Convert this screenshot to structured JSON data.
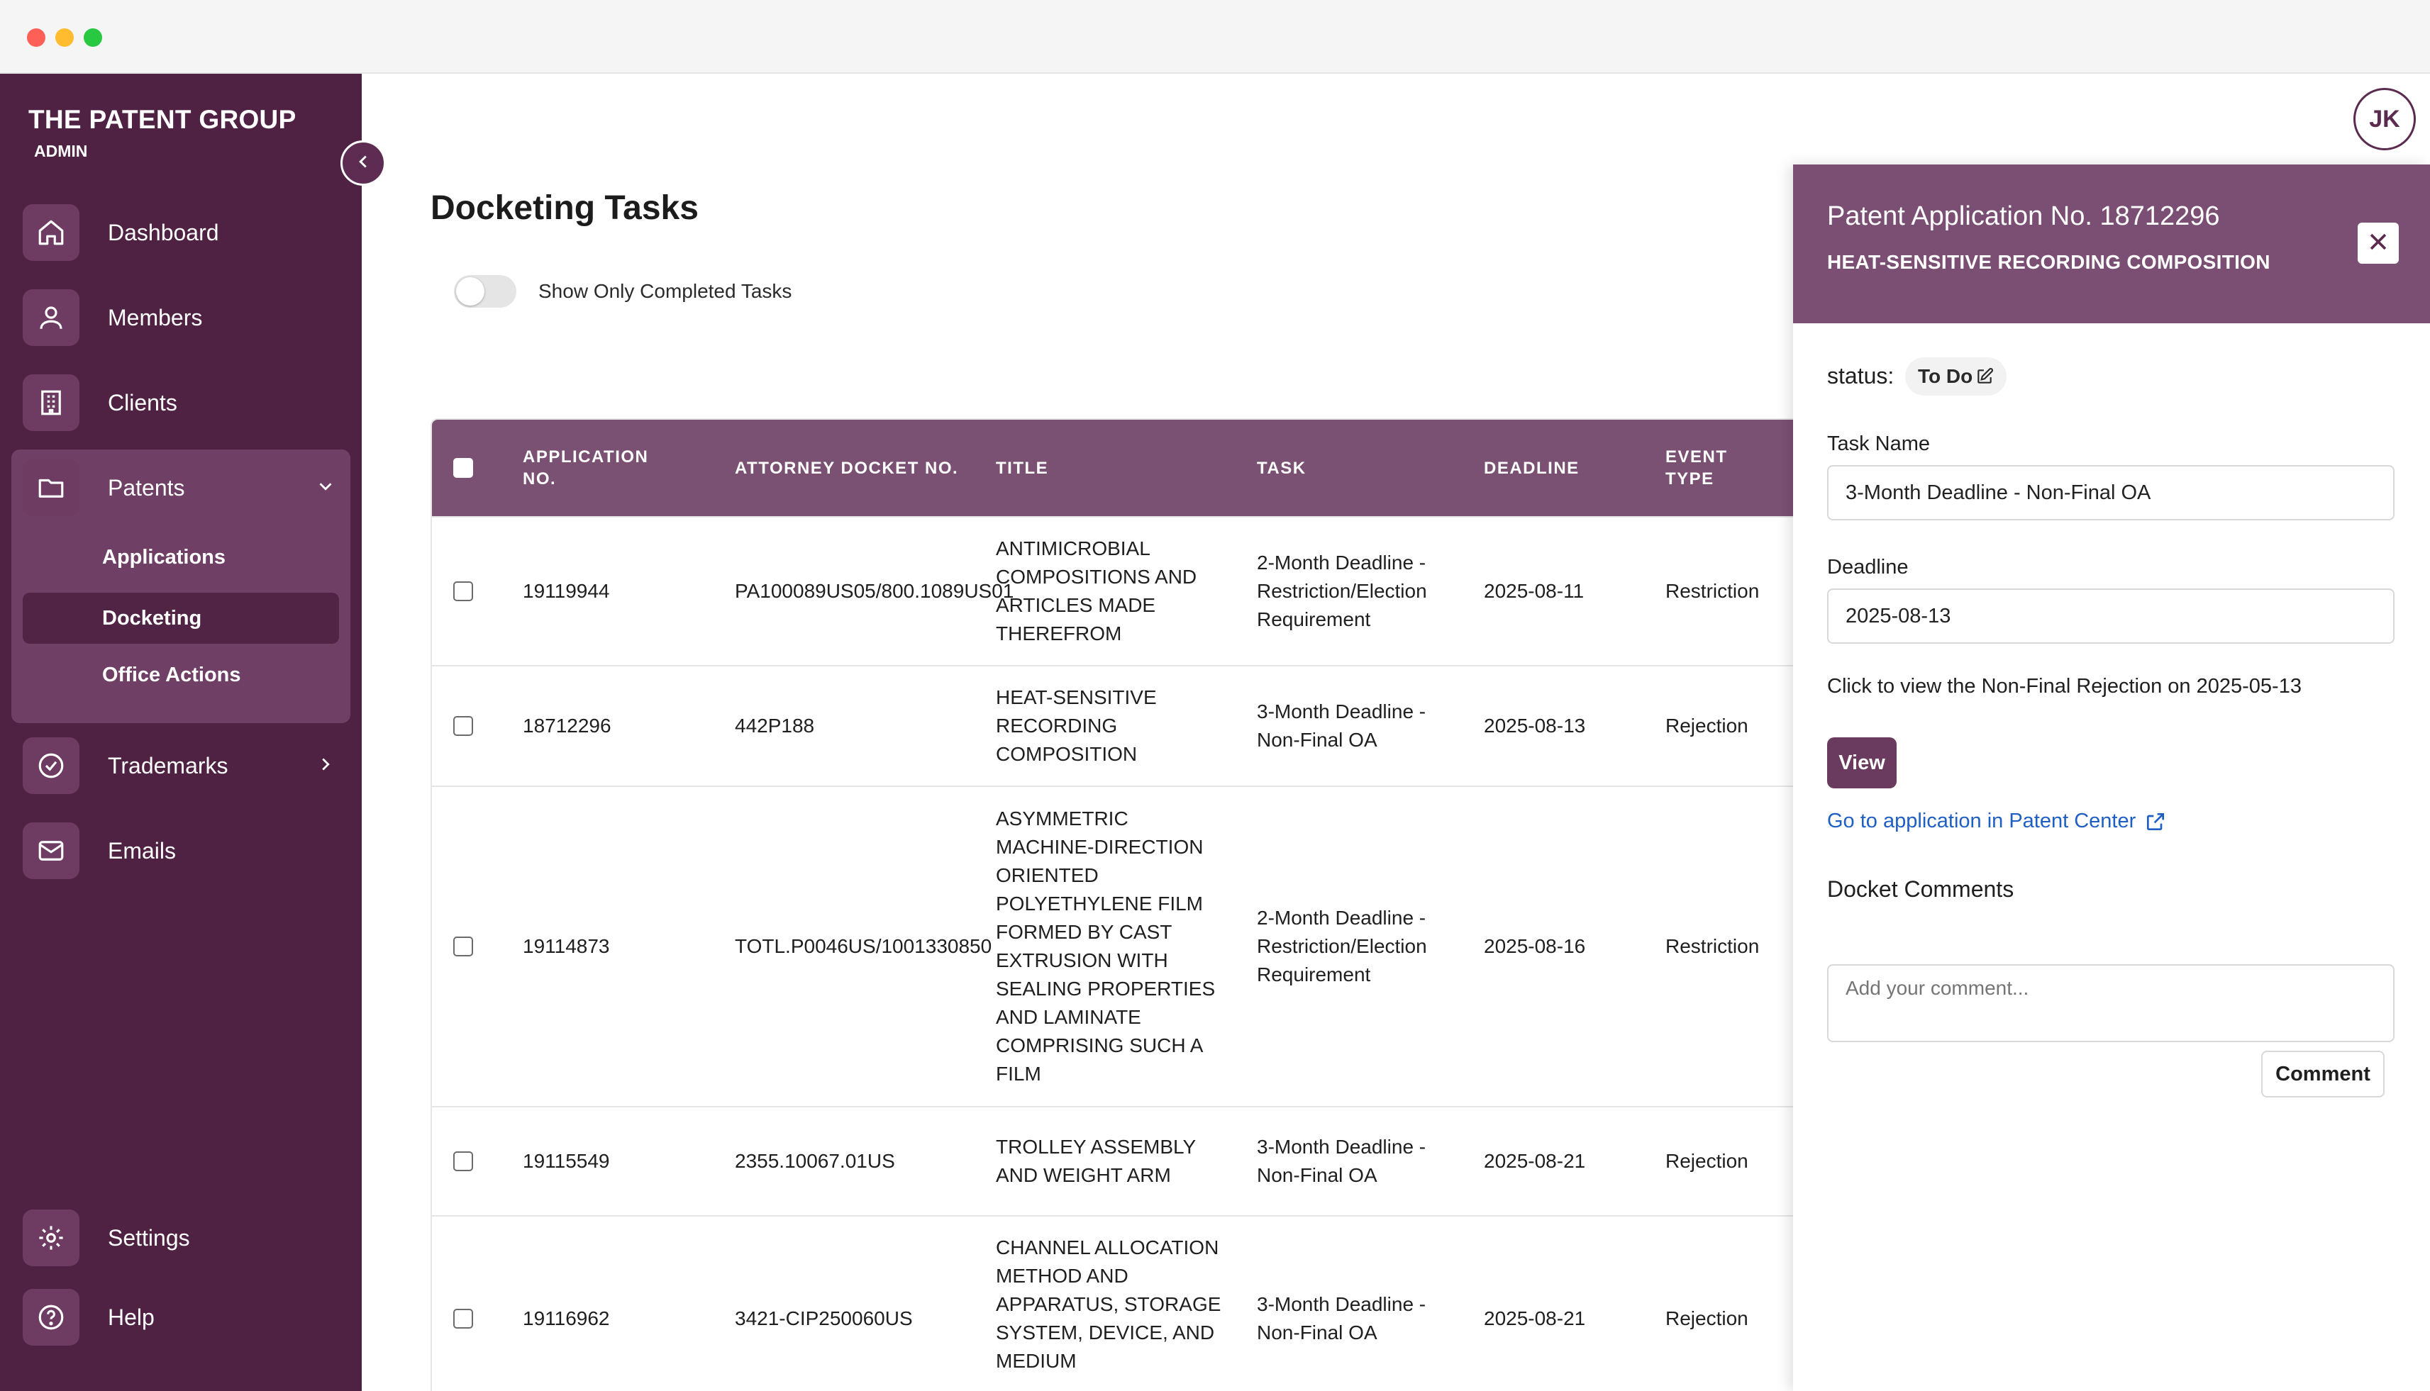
{
  "sidebar": {
    "brand": "THE PATENT GROUP",
    "role": "ADMIN",
    "items": [
      {
        "label": "Dashboard",
        "icon": "home-icon"
      },
      {
        "label": "Members",
        "icon": "users-icon"
      },
      {
        "label": "Clients",
        "icon": "building-icon"
      },
      {
        "label": "Patents",
        "icon": "folder-icon"
      },
      {
        "label": "Trademarks",
        "icon": "badge-check-icon"
      },
      {
        "label": "Emails",
        "icon": "mail-icon"
      },
      {
        "label": "Settings",
        "icon": "gear-icon"
      },
      {
        "label": "Help",
        "icon": "help-icon"
      }
    ],
    "patents_sub": [
      {
        "label": "Applications"
      },
      {
        "label": "Docketing"
      },
      {
        "label": "Office Actions"
      }
    ]
  },
  "header": {
    "avatar_initials": "JK"
  },
  "main": {
    "title": "Docketing Tasks",
    "toggle_label": "Show Only Completed Tasks",
    "columns": [
      "APPLICATION NO.",
      "ATTORNEY DOCKET NO.",
      "TITLE",
      "TASK",
      "DEADLINE",
      "EVENT TYPE"
    ],
    "rows": [
      {
        "app_no": "19119944",
        "docket": "PA100089US05/800.1089US01",
        "title": "ANTIMICROBIAL COMPOSITIONS AND ARTICLES MADE THEREFROM",
        "task": "2-Month Deadline - Restriction/Election Requirement",
        "deadline": "2025-08-11",
        "event": "Restriction"
      },
      {
        "app_no": "18712296",
        "docket": "442P188",
        "title": "HEAT-SENSITIVE RECORDING COMPOSITION",
        "task": "3-Month Deadline - Non-Final OA",
        "deadline": "2025-08-13",
        "event": "Rejection"
      },
      {
        "app_no": "19114873",
        "docket": "TOTL.P0046US/1001330850",
        "title": "ASYMMETRIC MACHINE-DIRECTION ORIENTED POLYETHYLENE FILM FORMED BY CAST EXTRUSION WITH SEALING PROPERTIES AND LAMINATE COMPRISING SUCH A FILM",
        "task": "2-Month Deadline - Restriction/Election Requirement",
        "deadline": "2025-08-16",
        "event": "Restriction"
      },
      {
        "app_no": "19115549",
        "docket": "2355.10067.01US",
        "title": "TROLLEY ASSEMBLY AND WEIGHT ARM",
        "task": "3-Month Deadline - Non-Final OA",
        "deadline": "2025-08-21",
        "event": "Rejection"
      },
      {
        "app_no": "19116962",
        "docket": "3421-CIP250060US",
        "title": "CHANNEL ALLOCATION METHOD AND APPARATUS, STORAGE SYSTEM, DEVICE, AND MEDIUM",
        "task": "3-Month Deadline - Non-Final OA",
        "deadline": "2025-08-21",
        "event": "Rejection"
      }
    ]
  },
  "panel": {
    "title": "Patent Application No. 18712296",
    "subtitle": "HEAT-SENSITIVE RECORDING COMPOSITION",
    "status_label": "status:",
    "status_value": "To Do",
    "task_name_label": "Task Name",
    "task_name_value": "3-Month Deadline - Non-Final OA",
    "deadline_label": "Deadline",
    "deadline_value": "2025-08-13",
    "note": "Click to view the Non-Final Rejection on 2025-05-13",
    "view_label": "View",
    "link_label": "Go to application in Patent Center",
    "comments_heading": "Docket Comments",
    "comment_placeholder": "Add your comment...",
    "comment_button": "Comment"
  },
  "colors": {
    "sidebar_bg": "#4f2143",
    "accent": "#7b4f73",
    "link": "#1f5fc4"
  }
}
